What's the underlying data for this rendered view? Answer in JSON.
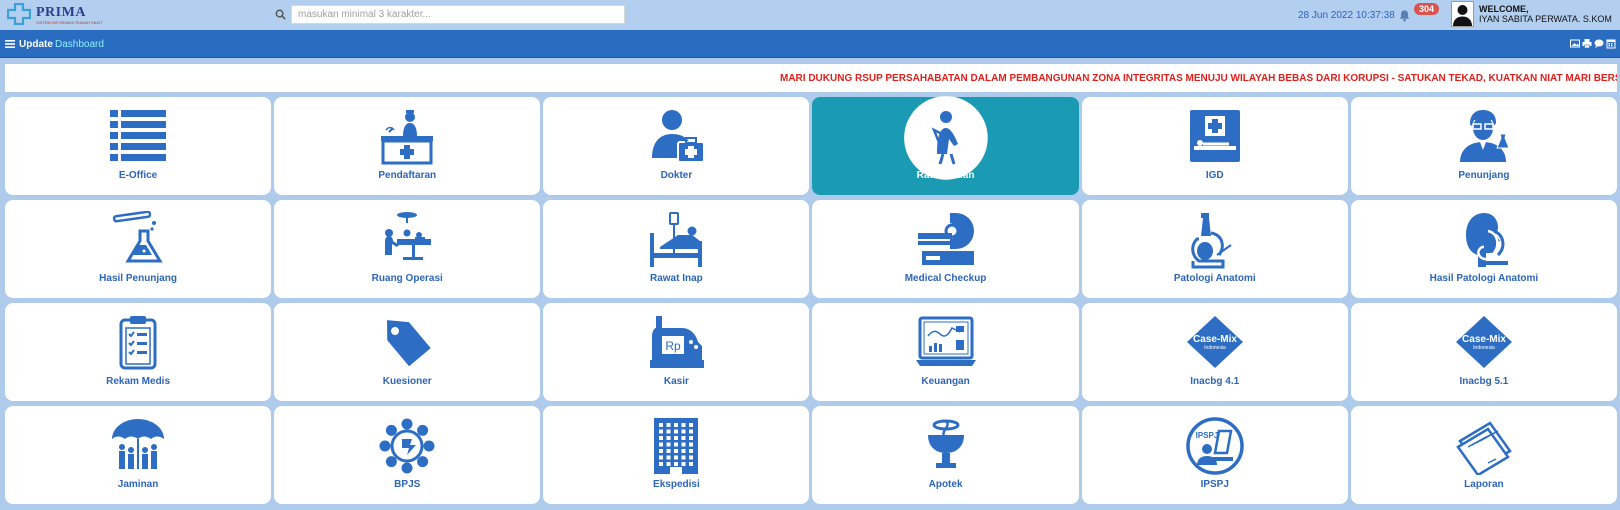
{
  "header": {
    "logo_text": "PRIMA",
    "logo_subtext": "SISTEM INFORMASI RUMAH SAKIT",
    "search_placeholder": "masukan minimal 3 karakter...",
    "datetime": "28 Jun 2022 10:37:38",
    "notification_count": "304",
    "welcome_label": "WELCOME,",
    "user_name": "IYAN SABITA PERWATA. S.KOM"
  },
  "toolbar": {
    "update_label": "Update",
    "dashboard_label": "Dashboard"
  },
  "marquee": {
    "text": "MARI DUKUNG RSUP PERSAHABATAN DALAM PEMBANGUNAN ZONA INTEGRITAS MENUJU WILAYAH BEBAS DARI KORUPSI - SATUKAN TEKAD, KUATKAN NIAT MARI BERSAMA KITA BERANTAS KORUPSI"
  },
  "tiles": [
    {
      "label": "E-Office",
      "icon": "list-icon"
    },
    {
      "label": "Pendaftaran",
      "icon": "registration-desk-icon"
    },
    {
      "label": "Dokter",
      "icon": "doctor-icon"
    },
    {
      "label": "Rawat Jalan",
      "icon": "outpatient-icon",
      "active": true
    },
    {
      "label": "IGD",
      "icon": "emergency-icon"
    },
    {
      "label": "Penunjang",
      "icon": "scientist-icon"
    },
    {
      "label": "Hasil Penunjang",
      "icon": "lab-flask-icon"
    },
    {
      "label": "Ruang Operasi",
      "icon": "operating-room-icon"
    },
    {
      "label": "Rawat Inap",
      "icon": "hospital-bed-icon"
    },
    {
      "label": "Medical Checkup",
      "icon": "mri-scanner-icon"
    },
    {
      "label": "Patologi Anatomi",
      "icon": "microscope-icon"
    },
    {
      "label": "Hasil Patologi Anatomi",
      "icon": "head-microscope-icon"
    },
    {
      "label": "Rekam Medis",
      "icon": "clipboard-icon"
    },
    {
      "label": "Kuesioner",
      "icon": "tag-icon"
    },
    {
      "label": "Kasir",
      "icon": "cash-register-icon"
    },
    {
      "label": "Keuangan",
      "icon": "laptop-chart-icon"
    },
    {
      "label": "Inacbg 4.1",
      "icon": "casemix-icon",
      "badge_text": "Case-Mix",
      "badge_sub": "Indonesia"
    },
    {
      "label": "Inacbg 5.1",
      "icon": "casemix-icon",
      "badge_text": "Case-Mix",
      "badge_sub": "Indonesia"
    },
    {
      "label": "Jaminan",
      "icon": "umbrella-family-icon"
    },
    {
      "label": "BPJS",
      "icon": "bpjs-icon"
    },
    {
      "label": "Ekspedisi",
      "icon": "building-icon"
    },
    {
      "label": "Apotek",
      "icon": "pharmacy-icon"
    },
    {
      "label": "IPSPJ",
      "icon": "ipspj-icon",
      "badge_text": "IPSPJ"
    },
    {
      "label": "Laporan",
      "icon": "documents-icon"
    }
  ],
  "colors": {
    "primary": "#2a6cbf",
    "icon_blue": "#2d6ec4",
    "active_tile": "#1a9bb3",
    "marquee_text": "#e0201c"
  }
}
